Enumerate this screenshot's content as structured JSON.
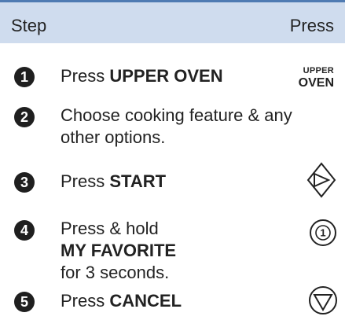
{
  "header": {
    "step": "Step",
    "press": "Press"
  },
  "steps": [
    {
      "number": "1",
      "prefix": "Press ",
      "bold": "UPPER OVEN",
      "suffix": "",
      "button": {
        "line1": "UPPER",
        "line2": "OVEN"
      }
    },
    {
      "number": "2",
      "line1": "Choose cooking feature & any",
      "line2": "other options."
    },
    {
      "number": "3",
      "prefix": "Press ",
      "bold": "START",
      "icon": "start-diamond-icon"
    },
    {
      "number": "4",
      "line1": "Press & hold",
      "bold": "MY FAVORITE",
      "line3": "for 3 seconds.",
      "icon": "my-favorite-icon",
      "icon_text": "1"
    },
    {
      "number": "5",
      "prefix": "Press ",
      "bold": "CANCEL",
      "icon": "cancel-icon"
    }
  ],
  "colors": {
    "header_bg": "#cfdcee",
    "top_rule": "#4f7bb2",
    "text": "#222222"
  }
}
